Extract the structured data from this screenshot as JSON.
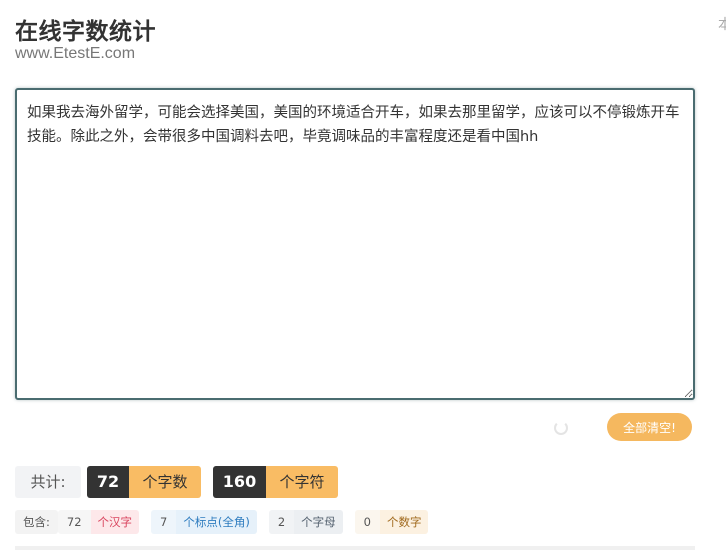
{
  "header": {
    "title": "在线字数统计",
    "site": "www.EtestE.com",
    "edge_glyph": "本"
  },
  "editor": {
    "text": "如果我去海外留学，可能会选择美国，美国的环境适合开车，如果去那里留学，应该可以不停锻炼开车技能。除此之外，会带很多中国调料去吧，毕竟调味品的丰富程度还是看中国hh"
  },
  "actions": {
    "clear_label": "全部清空!"
  },
  "totals": {
    "label": "共计:",
    "word_count": "72",
    "word_unit": "个字数",
    "char_count": "160",
    "char_unit": "个字符"
  },
  "details": {
    "label": "包含:",
    "items": [
      {
        "count": "72",
        "unit": "个汉字",
        "num_bg": "#f6f6f6",
        "unit_bg": "#fde8ea",
        "unit_color": "#d9455f"
      },
      {
        "count": "7",
        "unit": "个标点(全角)",
        "num_bg": "#eef5fb",
        "unit_bg": "#e6f1fa",
        "unit_color": "#2e7cbf"
      },
      {
        "count": "2",
        "unit": "个字母",
        "num_bg": "#f1f3f5",
        "unit_bg": "#eceff2",
        "unit_color": "#556270"
      },
      {
        "count": "0",
        "unit": "个数字",
        "num_bg": "#fbf6ee",
        "unit_bg": "#fcf1e1",
        "unit_color": "#a16a1e"
      }
    ]
  },
  "colors": {
    "accent": "#f9bc64",
    "dark": "#333333",
    "border": "#4a6c70"
  }
}
